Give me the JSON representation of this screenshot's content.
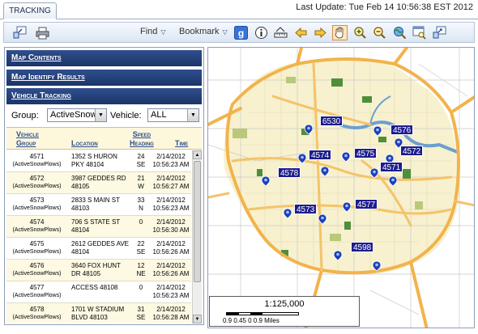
{
  "tab": {
    "label": "TRACKING"
  },
  "header": {
    "last_update": "Last Update: Tue Feb 14 10:56:38 EST 2012"
  },
  "toolbar": {
    "find_label": "Find",
    "bookmark_label": "Bookmark",
    "icons_left": [
      "zoom-extent-icon",
      "print-icon"
    ],
    "icons_right": [
      "google-icon",
      "info-icon",
      "measure-icon",
      "back-arrow-icon",
      "forward-arrow-icon",
      "pan-hand-icon",
      "zoom-in-icon",
      "zoom-out-icon",
      "zoom-world-icon",
      "zoom-window-icon",
      "zoom-full-icon"
    ]
  },
  "sections": {
    "map_contents": "Map Contents",
    "identify_results": "Map Identify Results",
    "vehicle_tracking": "Vehicle Tracking"
  },
  "filters": {
    "group_label": "Group:",
    "group_value": "ActiveSnowP",
    "vehicle_label": "Vehicle:",
    "vehicle_value": "ALL"
  },
  "table": {
    "headers": {
      "vehicle_group": "Vehicle\nGroup",
      "location": "Location",
      "speed_heading": "Speed\nHeading",
      "time": "Time"
    },
    "rows": [
      {
        "vehicle": "4571",
        "group": "(ActiveSnowPlows)",
        "location": "1352 S HURON PKY 48104",
        "speed": "24",
        "heading": "SE",
        "date": "2/14/2012",
        "time": "10:56:23 AM"
      },
      {
        "vehicle": "4572",
        "group": "(ActiveSnowPlows)",
        "location": "3987 GEDDES RD 48105",
        "speed": "21",
        "heading": "W",
        "date": "2/14/2012",
        "time": "10:56:27 AM"
      },
      {
        "vehicle": "4573",
        "group": "(ActiveSnowPlows)",
        "location": "2833 S MAIN ST 48103",
        "speed": "33",
        "heading": "N",
        "date": "2/14/2012",
        "time": "10:56:23 AM"
      },
      {
        "vehicle": "4574",
        "group": "(ActiveSnowPlows)",
        "location": "706 S STATE ST 48104",
        "speed": "0",
        "heading": "",
        "date": "2/14/2012",
        "time": "10:56:30 AM"
      },
      {
        "vehicle": "4575",
        "group": "(ActiveSnowPlows)",
        "location": "2612 GEDDES AVE 48104",
        "speed": "22",
        "heading": "SE",
        "date": "2/14/2012",
        "time": "10:56:26 AM"
      },
      {
        "vehicle": "4576",
        "group": "(ActiveSnowPlows)",
        "location": "3640 FOX HUNT DR 48105",
        "speed": "12",
        "heading": "NE",
        "date": "2/14/2012",
        "time": "10:56:26 AM"
      },
      {
        "vehicle": "4577",
        "group": "(ActiveSnowPlows)",
        "location": "ACCESS 48108",
        "speed": "0",
        "heading": "",
        "date": "2/14/2012",
        "time": "10:56:23 AM"
      },
      {
        "vehicle": "4578",
        "group": "(ActiveSnowPlows)",
        "location": "1701 W STADIUM BLVD 48103",
        "speed": "31",
        "heading": "SE",
        "date": "2/14/2012",
        "time": "10:56:28 AM"
      }
    ]
  },
  "map": {
    "vehicle_labels": [
      "6530",
      "4576",
      "4572",
      "4574",
      "4575",
      "4571",
      "4578",
      "4577",
      "4573",
      "4598"
    ],
    "scale_ratio": "1:125,000",
    "scale_ticks": "0.9 0.45  0         0.9 Miles",
    "colors": {
      "land": "#f7f1cf",
      "roads": "#f2b34b",
      "parks": "#4f8f3c",
      "water": "#6c9fd0",
      "labels": "#1d1d8e"
    }
  }
}
